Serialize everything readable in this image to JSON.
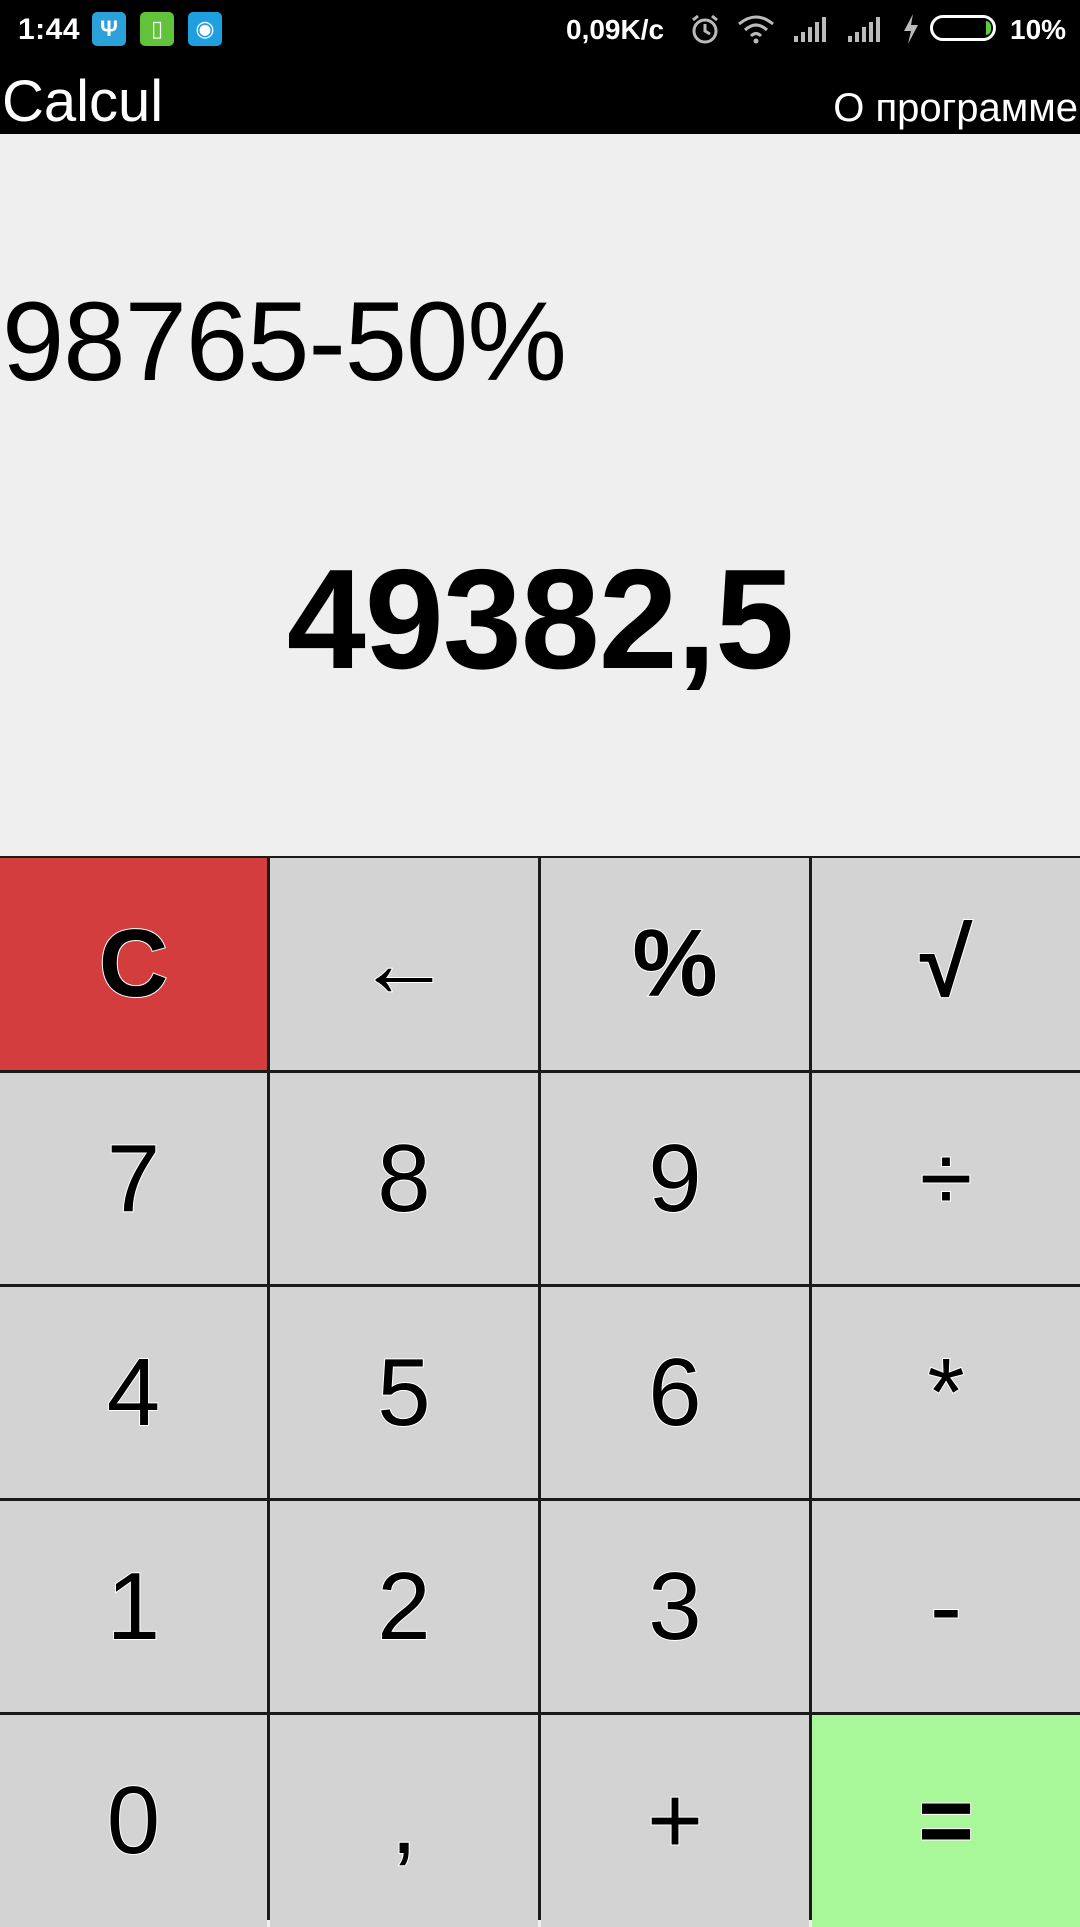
{
  "status_bar": {
    "time": "1:44",
    "app_icons": [
      {
        "name": "usb-icon",
        "glyph": "Ψ",
        "color": "#2aa1d8"
      },
      {
        "name": "battery-app-icon",
        "glyph": "▯",
        "color": "#62c23a"
      },
      {
        "name": "drop-app-icon",
        "glyph": "◉",
        "color": "#1ea0e0"
      }
    ],
    "network_speed": "0,09K/c",
    "battery_percent": "10%"
  },
  "app_bar": {
    "title": "Calcul",
    "about_label": "О программе"
  },
  "display": {
    "expression": "98765-50%",
    "result": "49382,5"
  },
  "keypad": {
    "rows": [
      [
        {
          "label": "C",
          "name": "clear-button",
          "style": "clear"
        },
        {
          "label": "←",
          "name": "backspace-button",
          "style": "bold"
        },
        {
          "label": "%",
          "name": "percent-button",
          "style": "bold"
        },
        {
          "label": "√",
          "name": "sqrt-button",
          "style": "bold"
        }
      ],
      [
        {
          "label": "7",
          "name": "digit-7-button"
        },
        {
          "label": "8",
          "name": "digit-8-button"
        },
        {
          "label": "9",
          "name": "digit-9-button"
        },
        {
          "label": "÷",
          "name": "divide-button"
        }
      ],
      [
        {
          "label": "4",
          "name": "digit-4-button"
        },
        {
          "label": "5",
          "name": "digit-5-button"
        },
        {
          "label": "6",
          "name": "digit-6-button"
        },
        {
          "label": "*",
          "name": "multiply-button"
        }
      ],
      [
        {
          "label": "1",
          "name": "digit-1-button"
        },
        {
          "label": "2",
          "name": "digit-2-button"
        },
        {
          "label": "3",
          "name": "digit-3-button"
        },
        {
          "label": "-",
          "name": "minus-button"
        }
      ],
      [
        {
          "label": "0",
          "name": "digit-0-button"
        },
        {
          "label": ",",
          "name": "decimal-comma-button"
        },
        {
          "label": "+",
          "name": "plus-button"
        },
        {
          "label": "=",
          "name": "equals-button",
          "style": "equals"
        }
      ]
    ]
  },
  "colors": {
    "clear_key": "#d33d3d",
    "equals_key": "#a8f799",
    "key": "#d3d3d3",
    "display_bg": "#efefef"
  }
}
